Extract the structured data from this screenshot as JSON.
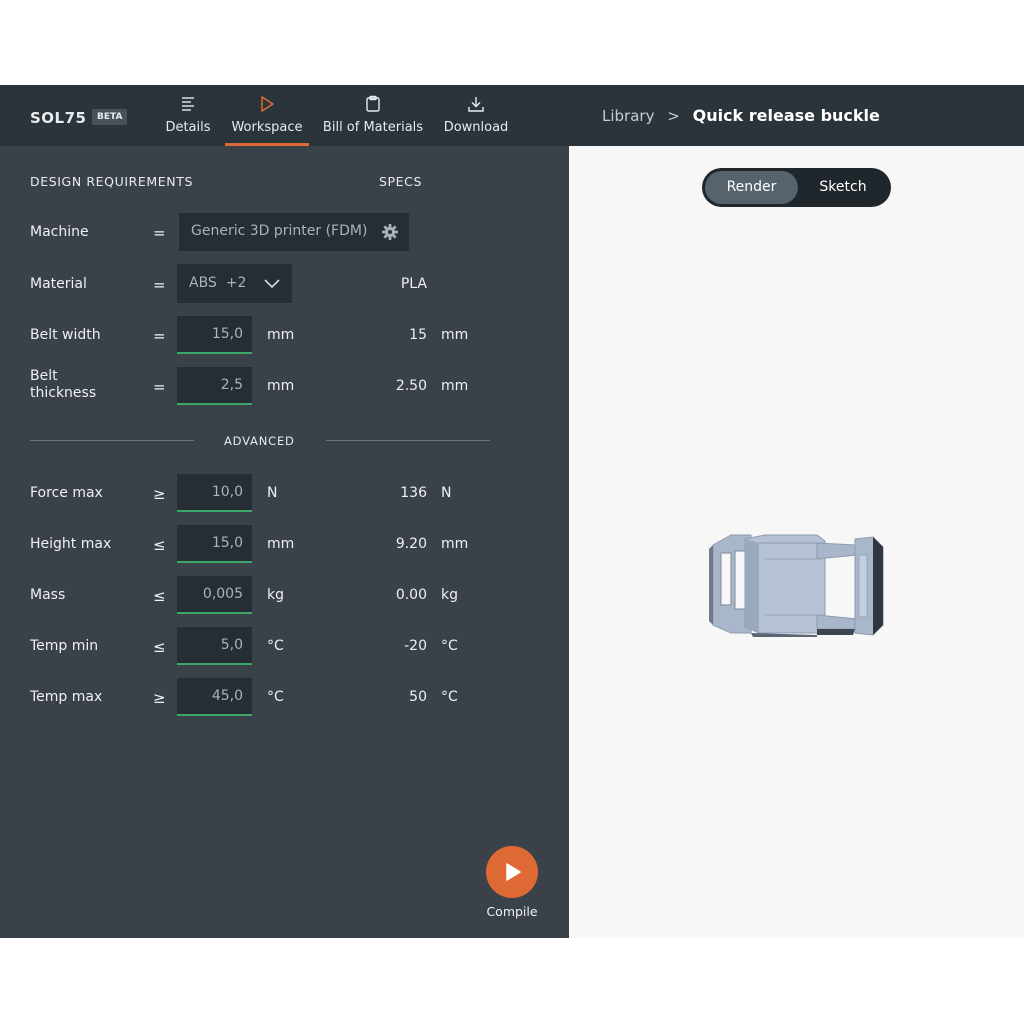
{
  "brand": {
    "name": "SOL75",
    "badge": "BETA"
  },
  "nav": {
    "tabs": [
      {
        "label": "Details",
        "icon": "list-icon"
      },
      {
        "label": "Workspace",
        "icon": "play-outline-icon",
        "active": true
      },
      {
        "label": "Bill of Materials",
        "icon": "clipboard-icon"
      },
      {
        "label": "Download",
        "icon": "download-icon"
      }
    ]
  },
  "breadcrumb": {
    "parent": "Library",
    "separator": ">",
    "current": "Quick release buckle"
  },
  "requirements": {
    "header": "DESIGN REQUIREMENTS",
    "specs_header": "SPECS",
    "machine": {
      "label": "Machine",
      "op": "=",
      "value": "Generic 3D printer (FDM)"
    },
    "material": {
      "label": "Material",
      "op": "=",
      "value": "ABS  +2",
      "spec": "PLA"
    },
    "belt_width": {
      "label": "Belt width",
      "op": "=",
      "value": "15,0",
      "unit": "mm",
      "spec": "15",
      "spec_unit": "mm"
    },
    "belt_thickness": {
      "label_line1": "Belt",
      "label_line2": "thickness",
      "op": "=",
      "value": "2,5",
      "unit": "mm",
      "spec": "2.50",
      "spec_unit": "mm"
    },
    "advanced_label": "ADVANCED",
    "advanced": [
      {
        "label": "Force max",
        "op": "≥",
        "value": "10,0",
        "unit": "N",
        "spec": "136",
        "spec_unit": "N"
      },
      {
        "label": "Height max",
        "op": "≤",
        "value": "15,0",
        "unit": "mm",
        "spec": "9.20",
        "spec_unit": "mm"
      },
      {
        "label": "Mass",
        "op": "≤",
        "value": "0,005",
        "unit": "kg",
        "spec": "0.00",
        "spec_unit": "kg"
      },
      {
        "label": "Temp min",
        "op": "≤",
        "value": "5,0",
        "unit": "°C",
        "spec": "-20",
        "spec_unit": "°C"
      },
      {
        "label": "Temp max",
        "op": "≥",
        "value": "45,0",
        "unit": "°C",
        "spec": "50",
        "spec_unit": "°C"
      }
    ]
  },
  "compile": {
    "label": "Compile"
  },
  "viewer": {
    "render_label": "Render",
    "sketch_label": "Sketch",
    "mode": "Render"
  },
  "colors": {
    "accent": "#e06a36",
    "topbar": "#2c343b",
    "panel": "#3a4149",
    "field": "#262d33",
    "valid": "#39a86a",
    "model": "#a9b7cb"
  }
}
